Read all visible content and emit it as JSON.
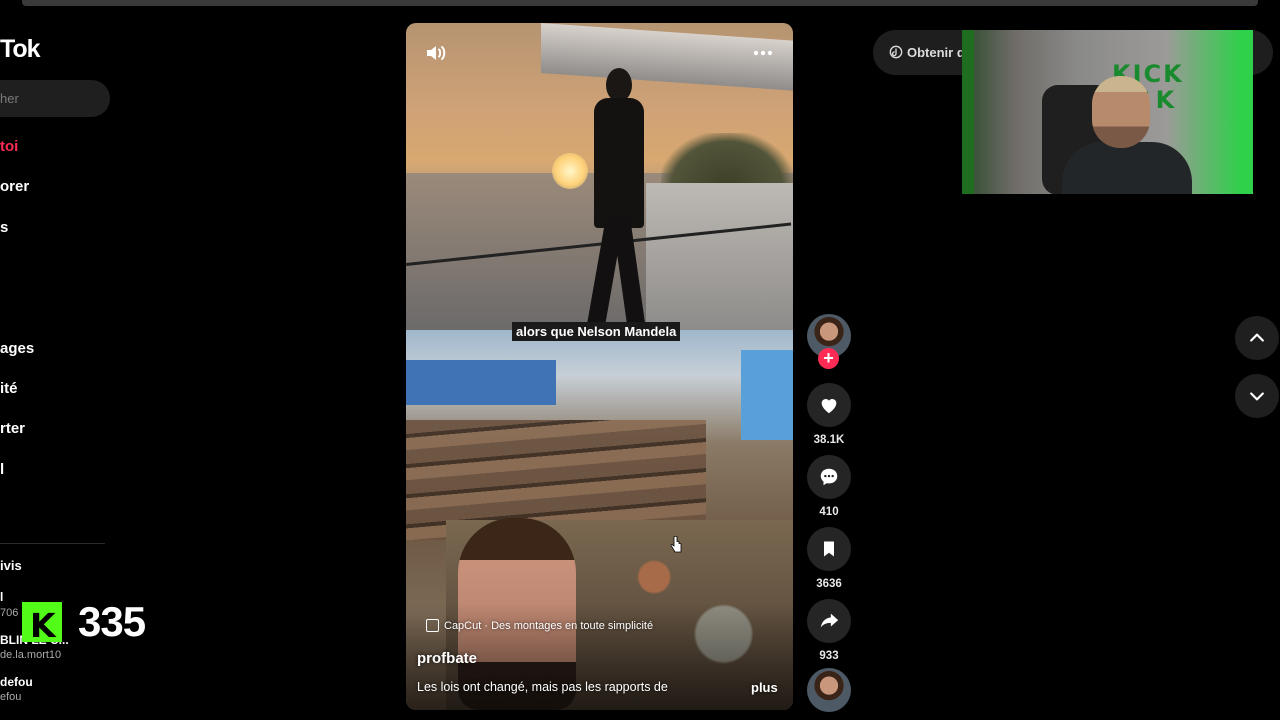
{
  "brand": {
    "logo_text": "Tok"
  },
  "search": {
    "placeholder": "her"
  },
  "nav": {
    "items": [
      {
        "label": "toi",
        "active": true
      },
      {
        "label": "orer",
        "active": false
      },
      {
        "label": "s",
        "active": false
      },
      {
        "label": "ages",
        "active": false
      },
      {
        "label": "ité",
        "active": false
      },
      {
        "label": "rter",
        "active": false
      },
      {
        "label": "l",
        "active": false
      }
    ]
  },
  "following": {
    "label": "ivis",
    "accounts": [
      {
        "name": "l",
        "handle": "706"
      },
      {
        "name": "BLIN   LE C...",
        "handle": "de.la.mort10"
      },
      {
        "name": "defou",
        "handle": "efou"
      }
    ]
  },
  "kick_overlay": {
    "logo_letter": "K",
    "viewer_count": "335",
    "accent": "#53fc18"
  },
  "video": {
    "caption": "alors que Nelson Mandela",
    "capcut_text": "CapCut · Des montages en toute simplicité",
    "author": "profbate",
    "description": "Les lois ont changé, mais pas les rapports de",
    "more_label": "plus",
    "volume_icon": "volume-icon",
    "more_icon": "more-options-icon"
  },
  "actions": {
    "follow_plus": "+",
    "likes": "38.1K",
    "comments": "410",
    "saves": "3636",
    "shares": "933"
  },
  "right_panel": {
    "obtain_label": "Obtenir d",
    "webcam_sign_top": "KICK",
    "webcam_sign_bottom": "CK"
  },
  "colors": {
    "accent_red": "#fe2c55",
    "background": "#000000",
    "button_bg": "#252525"
  }
}
